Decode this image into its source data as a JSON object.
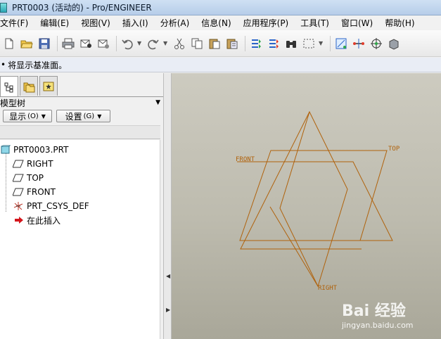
{
  "window": {
    "title": "PRT0003 (活动的) - Pro/ENGINEER"
  },
  "menu": [
    {
      "label": "文件(F)"
    },
    {
      "label": "编辑(E)"
    },
    {
      "label": "视图(V)"
    },
    {
      "label": "插入(I)"
    },
    {
      "label": "分析(A)"
    },
    {
      "label": "信息(N)"
    },
    {
      "label": "应用程序(P)"
    },
    {
      "label": "工具(T)"
    },
    {
      "label": "窗口(W)"
    },
    {
      "label": "帮助(H)"
    }
  ],
  "toolbar": {
    "icons": [
      "new-file-icon",
      "open-folder-icon",
      "save-icon",
      "print-icon",
      "email-icon",
      "email-attach-icon",
      "undo-icon",
      "redo-icon",
      "cut-icon",
      "copy-icon",
      "paste-icon",
      "paste-special-icon",
      "regenerate-icon",
      "regen-manager-icon",
      "find-icon",
      "select-box-icon",
      "model-tree-settings-icon",
      "datum-curve-icon",
      "datum-point-icon",
      "layer-icon"
    ]
  },
  "status": {
    "message": "将显示基准面。",
    "bullet": "•"
  },
  "panel": {
    "title": "模型树",
    "show_button": "显示",
    "show_key": "(O)",
    "settings_button": "设置",
    "settings_key": "(G)"
  },
  "tree": {
    "items": [
      {
        "label": "PRT0003.PRT",
        "icon": "part-icon"
      },
      {
        "label": "RIGHT",
        "icon": "datum-plane-icon"
      },
      {
        "label": "TOP",
        "icon": "datum-plane-icon"
      },
      {
        "label": "FRONT",
        "icon": "datum-plane-icon"
      },
      {
        "label": "PRT_CSYS_DEF",
        "icon": "csys-icon"
      },
      {
        "label": "在此插入",
        "icon": "insert-arrow-icon"
      }
    ]
  },
  "viewport": {
    "planes": [
      {
        "label": "FRONT"
      },
      {
        "label": "TOP"
      },
      {
        "label": "RIGHT"
      }
    ],
    "line_color": "#b0620c"
  },
  "watermark": {
    "main": "Bai 经验",
    "sub": "jingyan.baidu.com"
  }
}
